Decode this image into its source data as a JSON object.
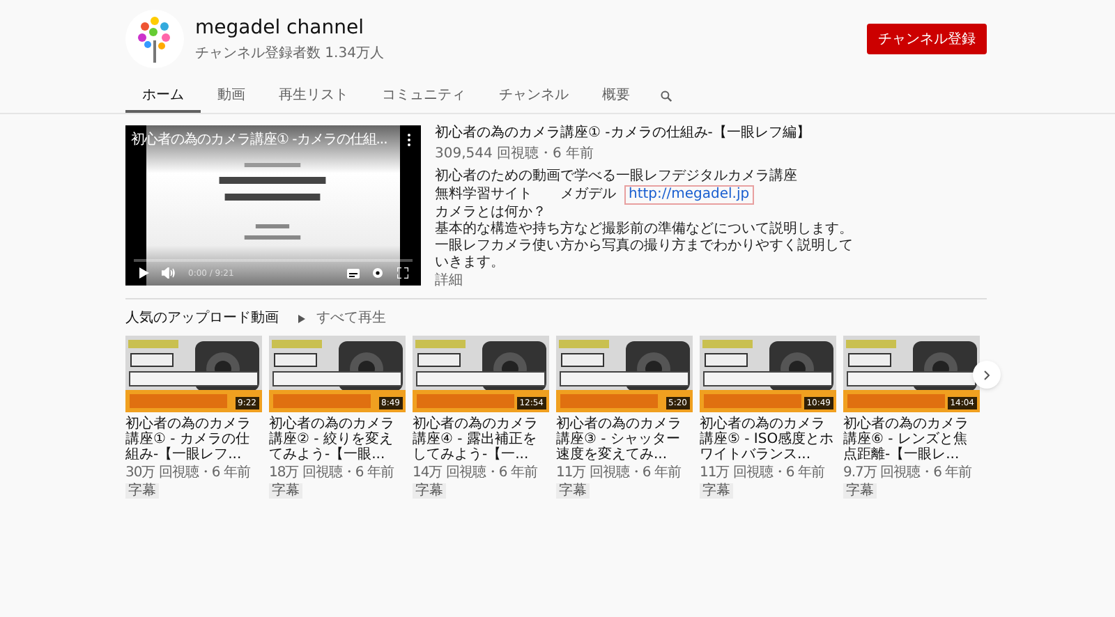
{
  "channel": {
    "name": "megadel channel",
    "subscribers": "チャンネル登録者数 1.34万人",
    "subscribe_button": "チャンネル登録"
  },
  "tabs": [
    {
      "label": "ホーム",
      "selected": true
    },
    {
      "label": "動画",
      "selected": false
    },
    {
      "label": "再生リスト",
      "selected": false
    },
    {
      "label": "コミュニティ",
      "selected": false
    },
    {
      "label": "チャンネル",
      "selected": false
    },
    {
      "label": "概要",
      "selected": false
    }
  ],
  "featured": {
    "player_title": "初心者の為のカメラ講座① -カメラの仕組...",
    "time": "0:00 / 9:21",
    "title": "初心者の為のカメラ講座① -カメラの仕組み-【一眼レフ編】",
    "meta": "309,544 回視聴・6 年前",
    "description": [
      "初心者のための動画で学べる一眼レフデジタルカメラ講座",
      "無料学習サイト　　メガデル",
      "カメラとは何か？",
      "基本的な構造や持ち方など撮影前の準備などについて説明します。",
      "一眼レフカメラ使い方から写真の撮り方までわかりやすく説明していきます。"
    ],
    "link": "http://megadel.jp",
    "more": "詳細"
  },
  "shelf": {
    "title": "人気のアップロード動画",
    "play_all": "すべて再生",
    "videos": [
      {
        "duration": "9:22",
        "title": "初心者の為のカメラ講座① - カメラの仕組み-【一眼レフ...",
        "meta": "30万 回視聴・6 年前",
        "badge": "字幕"
      },
      {
        "duration": "8:49",
        "title": "初心者の為のカメラ講座② - 絞りを変えてみよう-【一眼...",
        "meta": "18万 回視聴・6 年前",
        "badge": "字幕"
      },
      {
        "duration": "12:54",
        "title": "初心者の為のカメラ講座④ - 露出補正をしてみよう-【一...",
        "meta": "14万 回視聴・6 年前",
        "badge": "字幕"
      },
      {
        "duration": "5:20",
        "title": "初心者の為のカメラ講座③ - シャッター速度を変えてみ...",
        "meta": "11万 回視聴・6 年前",
        "badge": "字幕"
      },
      {
        "duration": "10:49",
        "title": "初心者の為のカメラ講座⑤ - ISO感度とホワイトバランス...",
        "meta": "11万 回視聴・6 年前",
        "badge": "字幕"
      },
      {
        "duration": "14:04",
        "title": "初心者の為のカメラ講座⑥ - レンズと焦点距離-【一眼レ...",
        "meta": "9.7万 回視聴・6 年前",
        "badge": "字幕"
      }
    ]
  }
}
